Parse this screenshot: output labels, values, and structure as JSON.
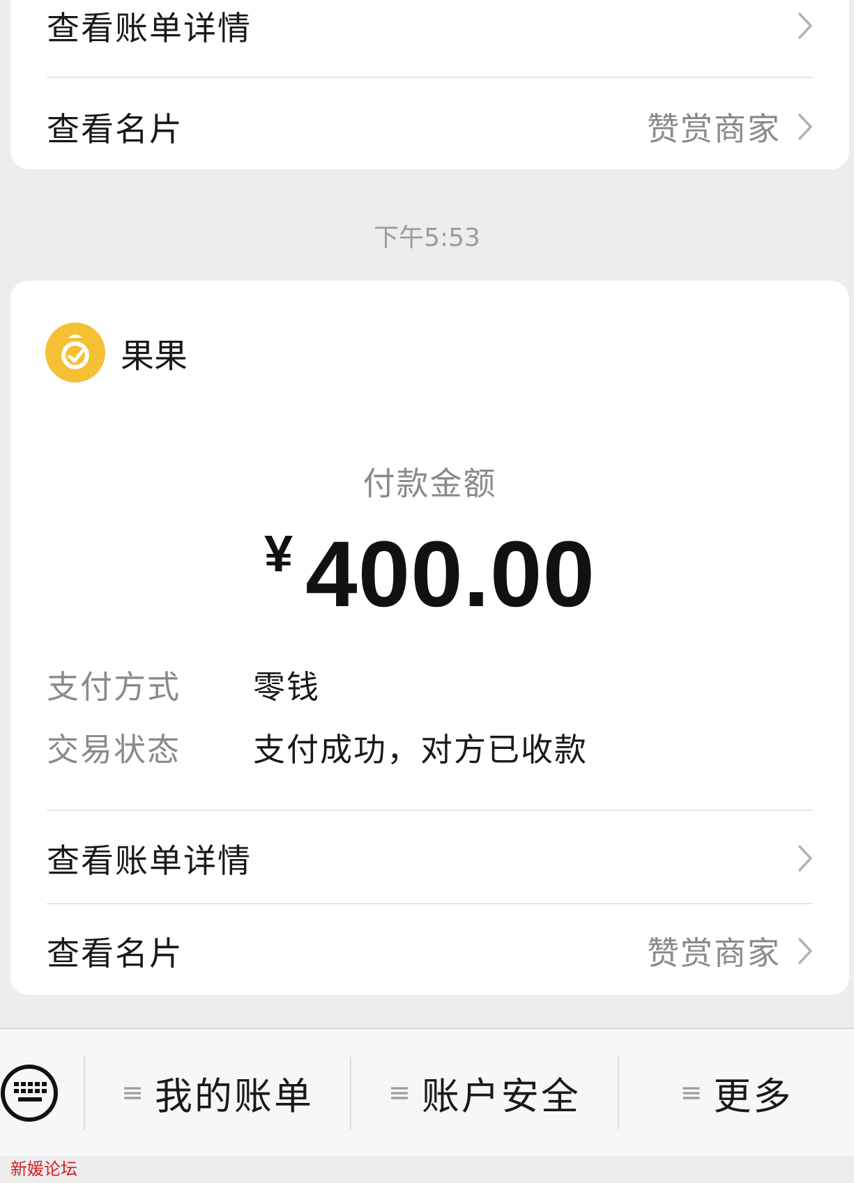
{
  "top_card": {
    "bill_detail_label": "查看账单详情",
    "card_label": "查看名片",
    "card_sub": "赞赏商家"
  },
  "timestamp": "下午5:53",
  "payment": {
    "merchant_name": "果果",
    "amount_label": "付款金额",
    "currency": "¥",
    "amount": "400.00",
    "method_key": "支付方式",
    "method_value": "零钱",
    "status_key": "交易状态",
    "status_value": "支付成功，对方已收款",
    "bill_detail_label": "查看账单详情",
    "card_label": "查看名片",
    "card_sub": "赞赏商家"
  },
  "bottom_menu": {
    "keyboard_icon": "keyboard-icon",
    "items": [
      {
        "label": "我的账单",
        "glyph": "≡"
      },
      {
        "label": "账户安全",
        "glyph": "≡"
      },
      {
        "label": "更多",
        "glyph": "≡"
      }
    ]
  },
  "watermark": "新媛论坛",
  "colors": {
    "background": "#ededed",
    "card": "#ffffff",
    "avatar": "#f5c033",
    "watermark": "#d11f27"
  }
}
